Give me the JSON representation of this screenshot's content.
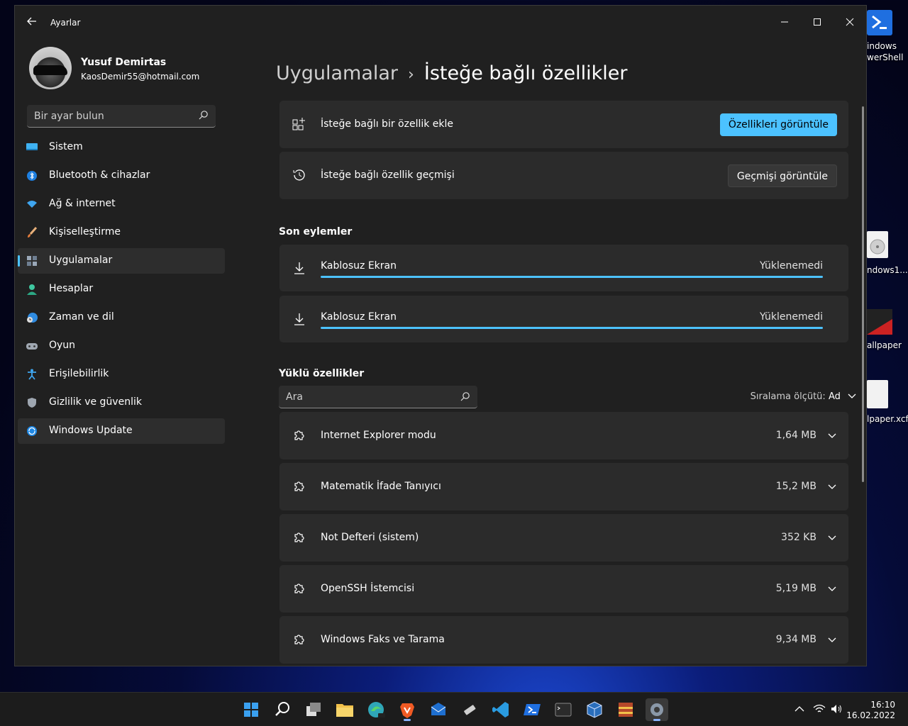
{
  "window": {
    "title": "Ayarlar"
  },
  "profile": {
    "name": "Yusuf Demirtas",
    "email": "KaosDemir55@hotmail.com"
  },
  "sidebar": {
    "search_placeholder": "Bir ayar bulun",
    "items": [
      {
        "label": "Sistem",
        "icon": "monitor-icon"
      },
      {
        "label": "Bluetooth & cihazlar",
        "icon": "bluetooth-icon"
      },
      {
        "label": "Ağ & internet",
        "icon": "wifi-icon"
      },
      {
        "label": "Kişiselleştirme",
        "icon": "brush-icon"
      },
      {
        "label": "Uygulamalar",
        "icon": "apps-icon",
        "selected": true
      },
      {
        "label": "Hesaplar",
        "icon": "person-icon"
      },
      {
        "label": "Zaman ve dil",
        "icon": "clock-globe-icon"
      },
      {
        "label": "Oyun",
        "icon": "gamepad-icon"
      },
      {
        "label": "Erişilebilirlik",
        "icon": "accessibility-icon"
      },
      {
        "label": "Gizlilik ve güvenlik",
        "icon": "shield-icon"
      },
      {
        "label": "Windows Update",
        "icon": "update-icon"
      }
    ]
  },
  "breadcrumb": {
    "parent": "Uygulamalar",
    "separator": "›",
    "current": "İsteğe bağlı özellikler"
  },
  "top_cards": {
    "add": {
      "label": "İsteğe bağlı bir özellik ekle",
      "button": "Özellikleri görüntüle"
    },
    "history": {
      "label": "İsteğe bağlı özellik geçmişi",
      "button": "Geçmişi görüntüle"
    }
  },
  "recent": {
    "title": "Son eylemler",
    "items": [
      {
        "name": "Kablosuz Ekran",
        "status": "Yüklenemedi",
        "progress": 1.0
      },
      {
        "name": "Kablosuz Ekran",
        "status": "Yüklenemedi",
        "progress": 1.0
      }
    ]
  },
  "installed": {
    "title": "Yüklü özellikler",
    "search_placeholder": "Ara",
    "sort_label": "Sıralama ölçütü:",
    "sort_value": "Ad",
    "items": [
      {
        "name": "Internet Explorer modu",
        "size": "1,64 MB"
      },
      {
        "name": "Matematik İfade Tanıyıcı",
        "size": "15,2 MB"
      },
      {
        "name": "Not Defteri (sistem)",
        "size": "352 KB"
      },
      {
        "name": "OpenSSH İstemcisi",
        "size": "5,19 MB"
      },
      {
        "name": "Windows Faks ve Tarama",
        "size": "9,34 MB"
      }
    ]
  },
  "desktop_icons": [
    "indows",
    "werShell",
    "ndows1...",
    "allpaper",
    "lpaper.xcf"
  ],
  "taskbar": {
    "time": "16:10",
    "date": "16.02.2022",
    "accent": "#4cc2ff"
  }
}
